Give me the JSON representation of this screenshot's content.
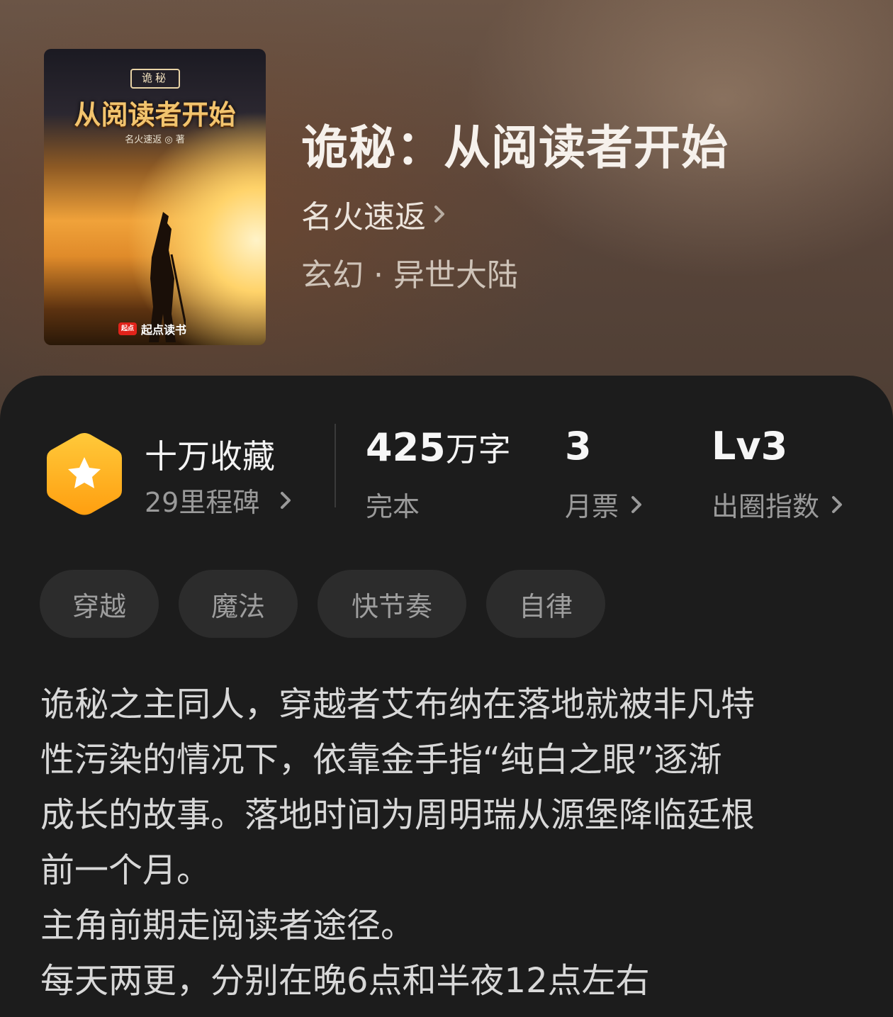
{
  "book": {
    "cover": {
      "tag": "诡秘",
      "title": "从阅读者开始",
      "author": "名火速返 ◎ 著",
      "publisher": "起点读书",
      "publisher_badge": "起点"
    },
    "title": "诡秘：从阅读者开始",
    "author": "名火速返",
    "genre": "玄幻 · 异世大陆"
  },
  "stats": {
    "collection_title": "十万收藏",
    "collection_sub": "29里程碑",
    "words_number": "425",
    "words_unit": "万字",
    "words_sub": "完本",
    "monthly_votes_number": "3",
    "monthly_votes_sub": "月票",
    "influence_number": "Lv3",
    "influence_sub": "出圈指数"
  },
  "tags": [
    "穿越",
    "魔法",
    "快节奏",
    "自律"
  ],
  "description": {
    "line1": "诡秘之主同人，穿越者艾布纳在落地就被非凡特",
    "line2": "性污染的情况下，依靠金手指“纯白之眼”逐渐",
    "line3": "成长的故事。落地时间为周明瑞从源堡降临廷根",
    "line4": "前一个月。",
    "line5": "主角前期走阅读者途径。",
    "line6": "每天两更，分别在晚6点和半夜12点左右"
  },
  "colors": {
    "panel_bg": "#1c1c1c",
    "tag_bg": "#2c2c2c",
    "badge_gold": "#ffb81f",
    "publisher_red": "#e2231a"
  },
  "icons": {
    "badge": "star-hexagon-icon",
    "chevron": "chevron-right-icon"
  }
}
